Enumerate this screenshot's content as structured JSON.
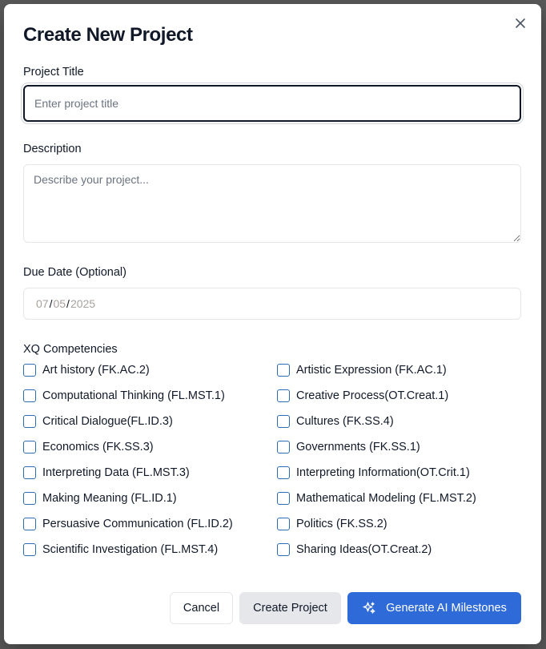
{
  "modal": {
    "title": "Create New Project",
    "close_icon": "close-icon"
  },
  "fields": {
    "title": {
      "label": "Project Title",
      "placeholder": "Enter project title",
      "value": ""
    },
    "description": {
      "label": "Description",
      "placeholder": "Describe your project...",
      "value": ""
    },
    "due_date": {
      "label": "Due Date (Optional)",
      "month": "07",
      "day": "05",
      "year": "2025",
      "separator": "/"
    }
  },
  "competencies": {
    "label": "XQ Competencies",
    "items": [
      {
        "label": "Art history (FK.AC.2)",
        "checked": false
      },
      {
        "label": "Artistic Expression (FK.AC.1)",
        "checked": false
      },
      {
        "label": "Computational Thinking (FL.MST.1)",
        "checked": false
      },
      {
        "label": "Creative Process(OT.Creat.1)",
        "checked": false
      },
      {
        "label": "Critical Dialogue(FL.ID.3)",
        "checked": false
      },
      {
        "label": "Cultures (FK.SS.4)",
        "checked": false
      },
      {
        "label": "Economics (FK.SS.3)",
        "checked": false
      },
      {
        "label": "Governments (FK.SS.1)",
        "checked": false
      },
      {
        "label": "Interpreting Data (FL.MST.3)",
        "checked": false
      },
      {
        "label": "Interpreting Information(OT.Crit.1)",
        "checked": false
      },
      {
        "label": "Making Meaning (FL.ID.1)",
        "checked": false
      },
      {
        "label": "Mathematical Modeling (FL.MST.2)",
        "checked": false
      },
      {
        "label": "Persuasive Communication (FL.ID.2)",
        "checked": false
      },
      {
        "label": "Politics (FK.SS.2)",
        "checked": false
      },
      {
        "label": "Scientific Investigation (FL.MST.4)",
        "checked": false
      },
      {
        "label": "Sharing Ideas(OT.Creat.2)",
        "checked": false
      }
    ]
  },
  "actions": {
    "cancel_label": "Cancel",
    "create_label": "Create Project",
    "ai_label": "Generate AI Milestones",
    "ai_icon": "sparkles-icon"
  },
  "colors": {
    "primary": "#2f6bd8",
    "checkbox_border": "#2b6cb0",
    "secondary_bg": "#e5e7eb",
    "overlay": "#5a5a5a"
  }
}
